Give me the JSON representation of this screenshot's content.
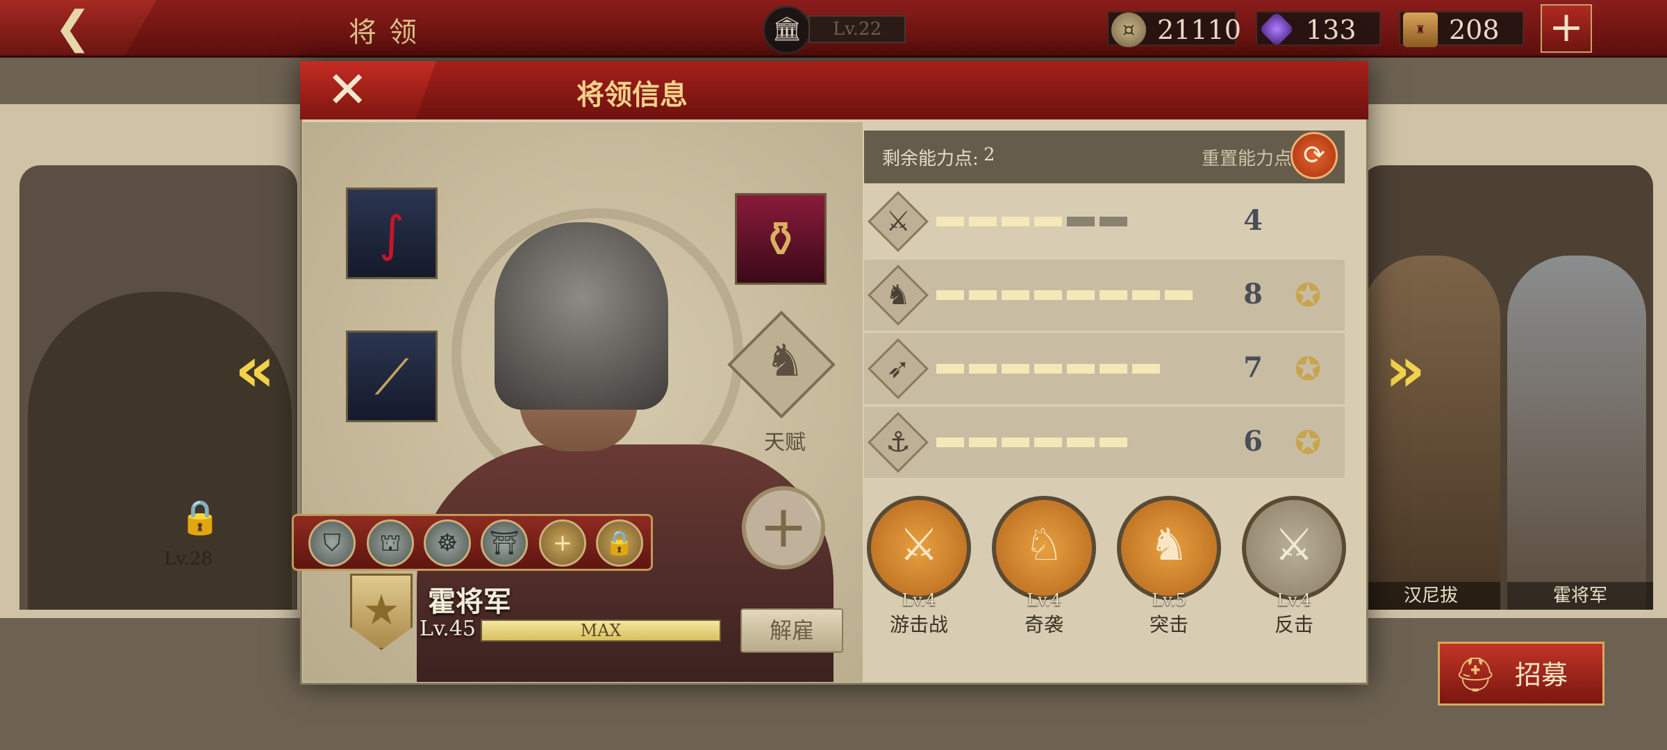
{
  "topbar": {
    "back_icon": "back-arrow-icon",
    "title": "将领",
    "base_level": "Lv.22",
    "resources": [
      {
        "name": "coin",
        "value": "21110"
      },
      {
        "name": "gem",
        "value": "133"
      },
      {
        "name": "honor",
        "value": "208"
      }
    ],
    "add_label": "+"
  },
  "roster": {
    "left_level": "Lv.28",
    "right_names": [
      "汉尼拔",
      "霍将军"
    ],
    "recruit_label": "招募"
  },
  "modal": {
    "title": "将领信息",
    "talent_label": "天赋",
    "general": {
      "name": "霍将军",
      "level": "Lv.45",
      "exp_text": "MAX",
      "exp_fraction": 1.0,
      "dismiss_label": "解雇"
    },
    "skill_slots": [
      "skill-1",
      "skill-2",
      "skill-3",
      "skill-4",
      "add",
      "locked"
    ],
    "stats": {
      "points_label": "剩余能力点:",
      "points_value": "2",
      "reset_label": "重置能力点",
      "rows": [
        {
          "icon": "sword-icon",
          "value": "4",
          "filled": 4,
          "total": 6,
          "medal": false
        },
        {
          "icon": "horse-icon",
          "value": "8",
          "filled": 8,
          "total": 8,
          "medal": true
        },
        {
          "icon": "bow-icon",
          "value": "7",
          "filled": 7,
          "total": 7,
          "medal": true
        },
        {
          "icon": "anchor-icon",
          "value": "6",
          "filled": 6,
          "total": 6,
          "medal": true
        }
      ]
    },
    "tactics": [
      {
        "level": "Lv.4",
        "name": "游击战",
        "active": true
      },
      {
        "level": "Lv.4",
        "name": "奇袭",
        "active": true
      },
      {
        "level": "Lv.5",
        "name": "突击",
        "active": true
      },
      {
        "level": "Lv.4",
        "name": "反击",
        "active": false
      }
    ]
  },
  "colors": {
    "accent_red": "#8a1d1a",
    "gold": "#f2d24a",
    "stat_fill": "#f4e8b8",
    "stat_empty": "#8a8270"
  }
}
